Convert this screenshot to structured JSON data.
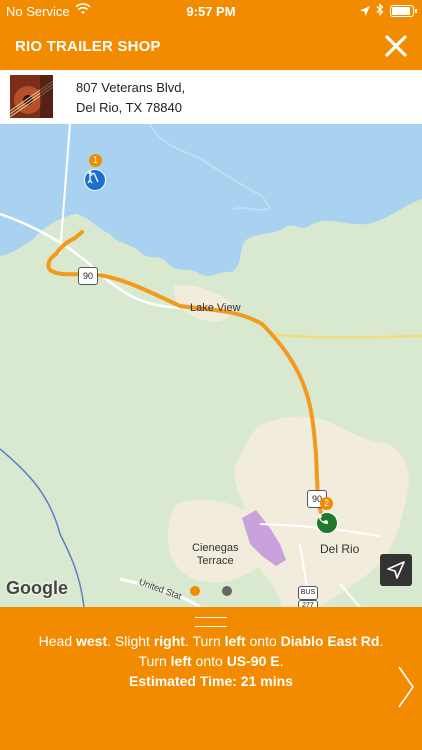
{
  "status": {
    "carrier": "No Service",
    "time": "9:57 PM"
  },
  "header": {
    "title": "RIO TRAILER SHOP"
  },
  "address": {
    "line1": "807 Veterans Blvd,",
    "line2": "Del Rio, TX 78840"
  },
  "map": {
    "labels": {
      "lake_view": "Lake View",
      "cienegas": "Cienegas\nTerrace",
      "del_rio": "Del Rio",
      "united": "United Stat"
    },
    "shields": {
      "us90_west": "90",
      "us90_east": "90",
      "bus": "BUS",
      "r277": "277"
    },
    "badges": {
      "stop1": "1",
      "stop2": "2"
    },
    "attribution": "Google",
    "page_dot_colors": [
      "#f38b00",
      "#666666"
    ]
  },
  "directions": {
    "segments": [
      {
        "t": "Head ",
        "b": false
      },
      {
        "t": "west",
        "b": true
      },
      {
        "t": ". Slight ",
        "b": false
      },
      {
        "t": "right",
        "b": true
      },
      {
        "t": ". Turn ",
        "b": false
      },
      {
        "t": "left",
        "b": true
      },
      {
        "t": " onto ",
        "b": false
      },
      {
        "t": "Diablo East Rd",
        "b": true
      },
      {
        "t": ". Turn ",
        "b": false
      },
      {
        "t": "left",
        "b": true
      },
      {
        "t": " onto ",
        "b": false
      },
      {
        "t": "US-90 E",
        "b": true
      },
      {
        "t": ".",
        "b": false
      }
    ],
    "eta": "Estimated Time: 21 mins"
  },
  "colors": {
    "accent": "#f38b00",
    "route": "#f39a1c",
    "water": "#a9d1f0"
  }
}
